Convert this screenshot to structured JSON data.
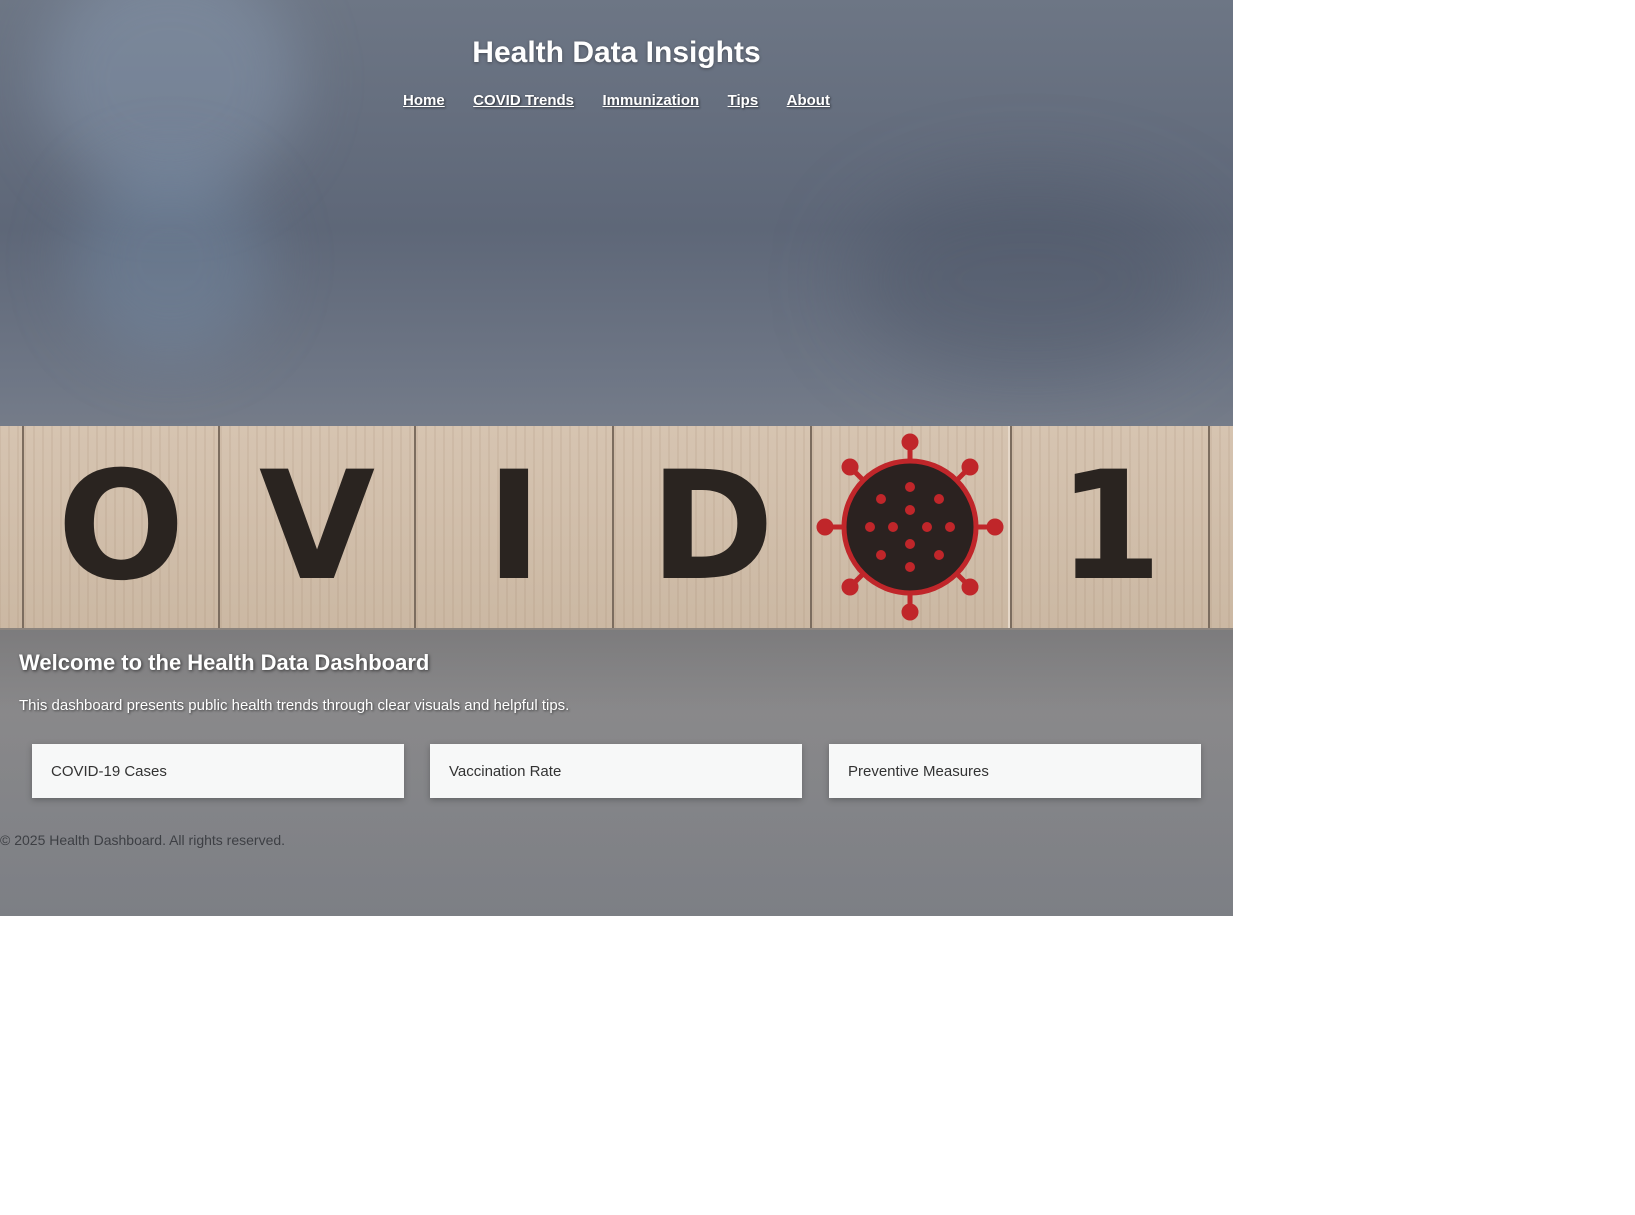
{
  "header": {
    "title": "Health Data Insights",
    "nav": [
      "Home",
      "COVID Trends",
      "Immunization",
      "Tips",
      "About"
    ]
  },
  "hero_image": {
    "letters": [
      "O",
      "V",
      "I",
      "D",
      "1"
    ]
  },
  "main": {
    "heading": "Welcome to the Health Data Dashboard",
    "intro": "This dashboard presents public health trends through clear visuals and helpful tips.",
    "cards": [
      "COVID-19 Cases",
      "Vaccination Rate",
      "Preventive Measures"
    ]
  },
  "footer": {
    "text": "© 2025 Health Dashboard. All rights reserved."
  },
  "colors": {
    "virus": "#c0262a",
    "virus_core": "#2b2220"
  }
}
